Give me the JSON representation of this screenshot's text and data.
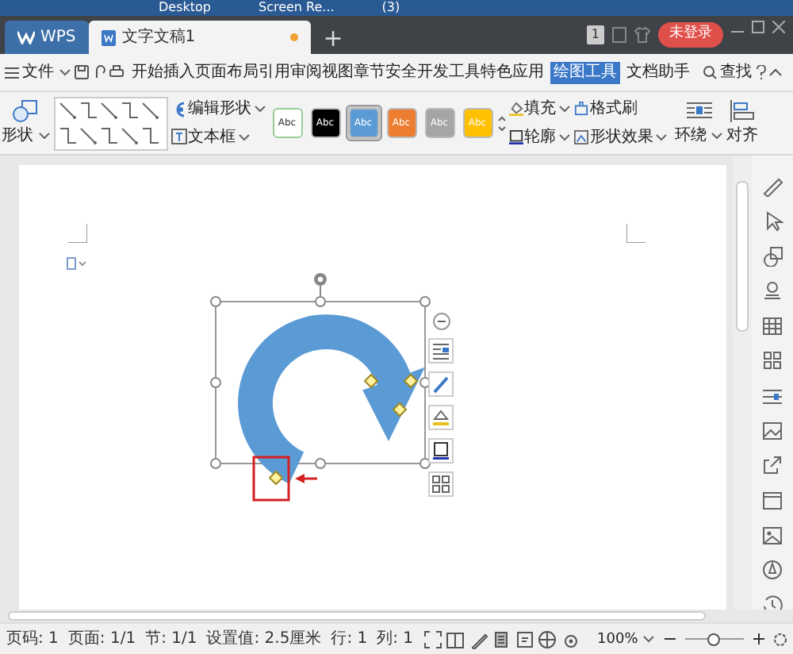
{
  "taskbar": {
    "items": [
      "Desktop",
      "Screen Re...",
      "(3)"
    ]
  },
  "tabs": [
    {
      "label": "WPS",
      "kind": "app",
      "selected": false
    },
    {
      "label": "文字文稿1",
      "kind": "doc",
      "selected": true
    }
  ],
  "new_tab": "+",
  "window_count": "1",
  "login_button": "未登录",
  "menu": {
    "file": "文件",
    "tabs": [
      {
        "label": "开始",
        "selected": false
      },
      {
        "label": "插入",
        "selected": false
      },
      {
        "label": "页面布局",
        "selected": false
      },
      {
        "label": "引用",
        "selected": false
      },
      {
        "label": "审阅",
        "selected": false
      },
      {
        "label": "视图",
        "selected": false
      },
      {
        "label": "章节",
        "selected": false
      },
      {
        "label": "安全",
        "selected": false
      },
      {
        "label": "开发工具",
        "selected": false
      },
      {
        "label": "特色应用",
        "selected": false
      },
      {
        "label": "绘图工具",
        "selected": true
      },
      {
        "label": "文档助手",
        "selected": false
      }
    ],
    "search": "查找"
  },
  "ribbon": {
    "shapes": "形状",
    "edit_shape": "编辑形状",
    "text_box": "文本框",
    "styles": [
      {
        "label": "Abc",
        "color": "#ffffff",
        "selected": false
      },
      {
        "label": "Abc",
        "color": "#000000",
        "selected": false
      },
      {
        "label": "Abc",
        "color": "#5b9bd5",
        "selected": true
      },
      {
        "label": "Abc",
        "color": "#ed7d31",
        "selected": false
      },
      {
        "label": "Abc",
        "color": "#a5a5a5",
        "selected": false
      },
      {
        "label": "Abc",
        "color": "#ffc000",
        "selected": false
      }
    ],
    "fill": "填充",
    "format_painter": "格式刷",
    "outline": "轮廓",
    "shape_effects": "形状效果",
    "wrap": "环绕",
    "align": "对齐"
  },
  "status_bar": {
    "items": [
      "页码: 1",
      "页面: 1/1",
      "节: 1/1",
      "设置值: 2.5厘米",
      "行: 1",
      "列: 1"
    ],
    "zoom": "100%",
    "zoom_slider": {
      "level": 0.5
    }
  }
}
